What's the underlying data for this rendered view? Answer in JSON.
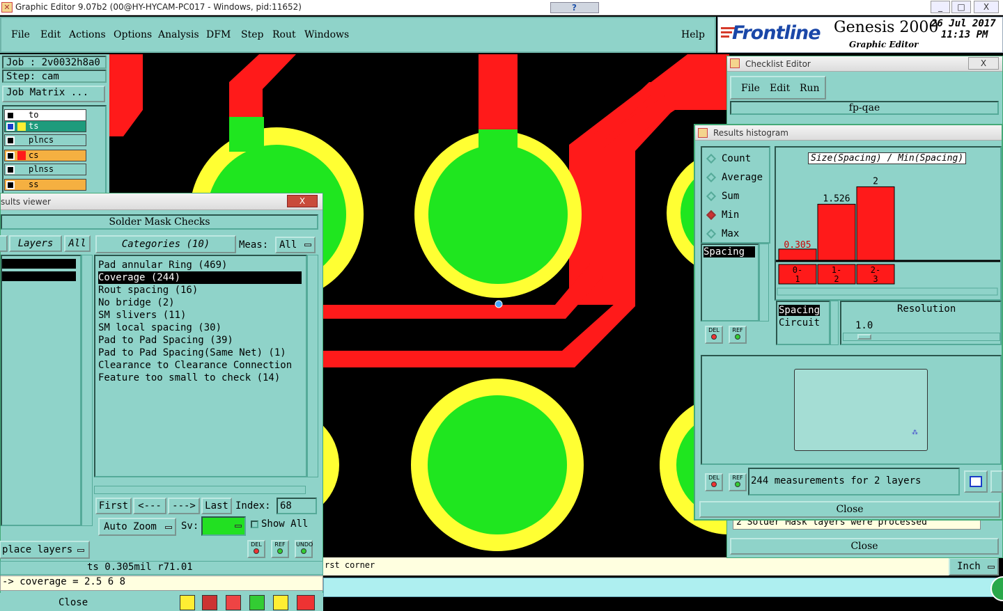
{
  "window": {
    "title": "Graphic Editor 9.07b2 (00@HY-HYCAM-PC017 - Windows, pid:11652)",
    "controls": [
      "_",
      "□",
      "X"
    ]
  },
  "menubar": {
    "items": [
      "File",
      "Edit",
      "Actions",
      "Options",
      "Analysis",
      "DFM",
      "Step",
      "Rout",
      "Windows"
    ],
    "help": "Help"
  },
  "logo": {
    "brand": "Frontline",
    "product": "Genesis 2000",
    "subtitle": "Graphic Editor",
    "date": "26 Jul 2017",
    "time": "11:13 PM"
  },
  "left_panel": {
    "job": "Job : 2v0032h8a0",
    "step": "Step: cam",
    "job_matrix": "Job Matrix ...",
    "layers": [
      {
        "name": "to",
        "color": "#ffffff"
      },
      {
        "name": "ts",
        "color": "#1e9b7c"
      },
      {
        "name": "plncs",
        "color": "#8fd3c9"
      },
      {
        "name": "cs",
        "color": "#f5b041"
      },
      {
        "name": "plnss",
        "color": "#8fd3c9"
      },
      {
        "name": "ss",
        "color": "#f5b041"
      }
    ]
  },
  "results_viewer": {
    "title": "sults viewer",
    "close_x": "X",
    "header": "Solder Mask Checks",
    "layers_tab": "Layers",
    "all_tab": "All",
    "categories_tab": "Categories (10)",
    "meas_label": "Meas:",
    "meas_value": "All",
    "categories": [
      "Pad annular Ring (469)",
      "Coverage (244)",
      "Rout spacing (16)",
      "No bridge (2)",
      "SM slivers (11)",
      "SM local spacing (30)",
      "Pad to Pad Spacing (39)",
      "Pad to Pad Spacing(Same Net) (1)",
      "Clearance to Clearance Connection",
      "Feature too small to check (14)"
    ],
    "nav": {
      "first": "First",
      "prev": "<---",
      "next": "--->",
      "last": "Last",
      "index_label": "Index:",
      "index_value": "68"
    },
    "auto_zoom": "Auto Zoom",
    "sv_label": "Sv:",
    "show_all": "Show All",
    "place_layers": "place layers",
    "btn_del": "DEL",
    "btn_ref": "REF",
    "btn_undo": "UNDO",
    "close": "Close"
  },
  "status": {
    "measure": "ts 0.305mil   r71.01",
    "command": "-> coverage = 2.5 6 8",
    "prompt": "rst corner",
    "units": "Inch"
  },
  "checklist_editor": {
    "title": "Checklist Editor",
    "close_x": "X",
    "menu": [
      "File",
      "Edit",
      "Run"
    ],
    "name": "fp-qae",
    "message": "2 Solder Mask layers were processed",
    "close": "Close"
  },
  "histogram": {
    "title": "Results histogram",
    "options": [
      "Count",
      "Average",
      "Sum",
      "Min",
      "Max"
    ],
    "selected_option": "Min",
    "chart_title": "Size(Spacing) / Min(Spacing)",
    "list": [
      "Spacing"
    ],
    "side_list": [
      "Spacing",
      "Circuit"
    ],
    "resolution_label": "Resolution",
    "resolution_value": "1.0",
    "measurements": "244 measurements for 2 layers",
    "btn_del": "DEL",
    "btn_ref": "REF",
    "close": "Close"
  },
  "chart_data": {
    "type": "bar",
    "categories": [
      "0-1",
      "1-2",
      "2-3"
    ],
    "values": [
      0.305,
      1.526,
      2
    ],
    "value_labels": [
      "0.305",
      "1.526",
      "2"
    ],
    "title": "Size(Spacing) / Min(Spacing)",
    "ylim": [
      0,
      2.5
    ],
    "bar_color": "#ff1a1a"
  }
}
